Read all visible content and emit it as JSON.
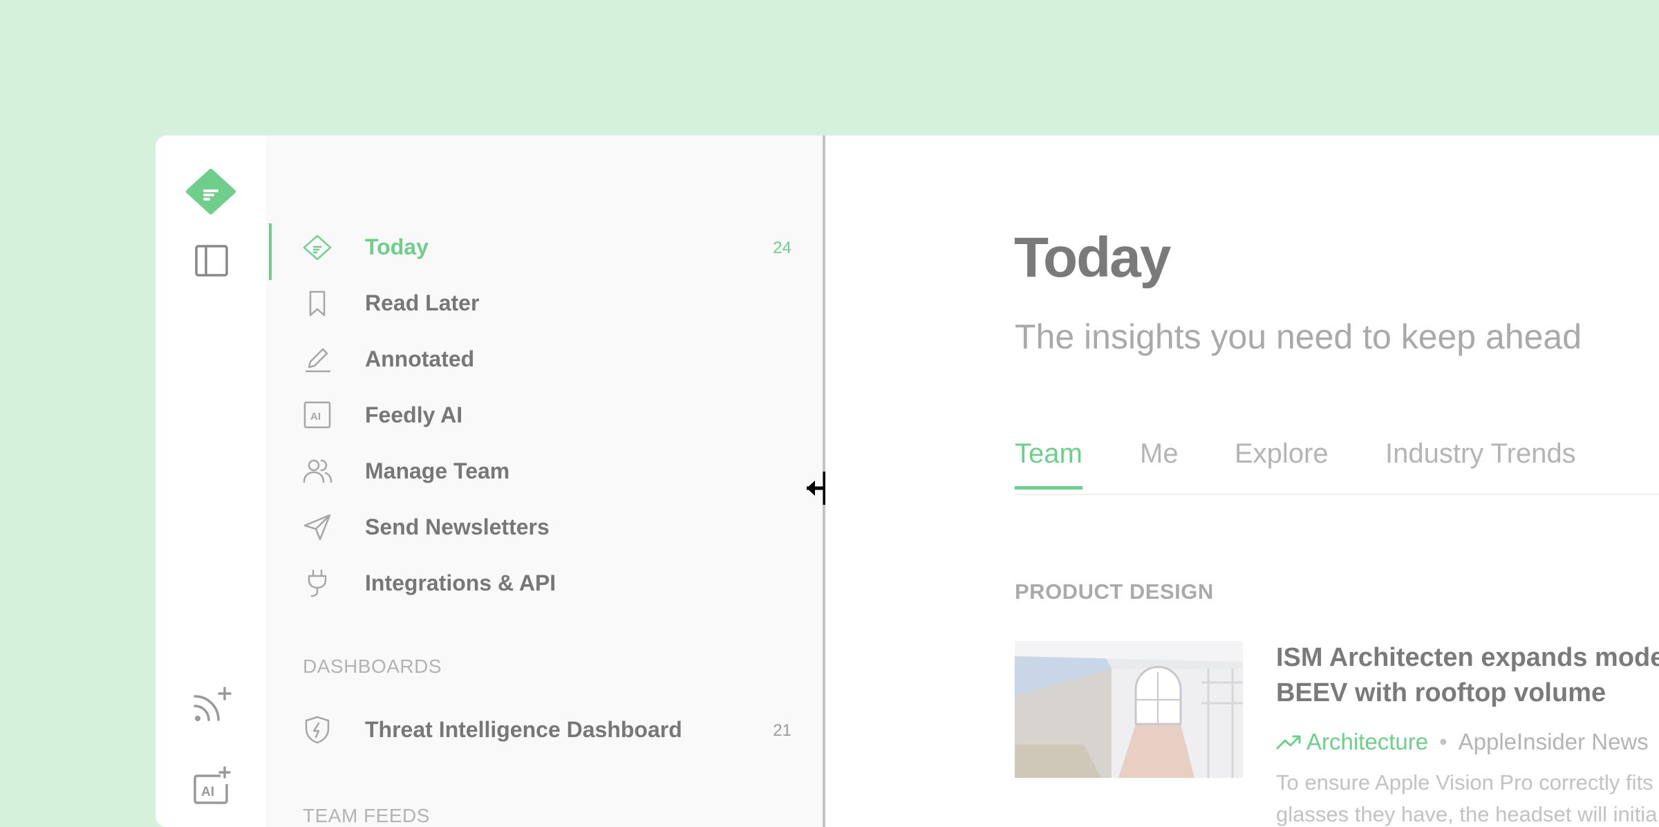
{
  "sidebar": {
    "nav_items": [
      {
        "label": "Today",
        "count": "24"
      },
      {
        "label": "Read Later"
      },
      {
        "label": "Annotated"
      },
      {
        "label": "Feedly AI"
      },
      {
        "label": "Manage Team"
      },
      {
        "label": "Send Newsletters"
      },
      {
        "label": "Integrations & API"
      }
    ],
    "dashboards_header": "DASHBOARDS",
    "dashboards": [
      {
        "label": "Threat Intelligence Dashboard",
        "count": "21"
      }
    ],
    "team_feeds_header": "TEAM FEEDS"
  },
  "icons": {
    "logo": "feedly-logo-icon",
    "toggle": "sidebar-toggle-icon",
    "rss_add": "rss-add-icon",
    "ai_add": "ai-add-icon",
    "feedly_ai_badge": "AI",
    "ai_add_badge": "AI"
  },
  "main": {
    "title": "Today",
    "subtitle": "The insights you need to keep ahead",
    "tabs": [
      "Team",
      "Me",
      "Explore",
      "Industry Trends"
    ],
    "section_label": "PRODUCT DESIGN",
    "article": {
      "title_line1": "ISM Architecten expands modernist",
      "title_line2": "BEEV with rooftop volume",
      "topic": "Architecture",
      "separator": "•",
      "source": "AppleInsider News",
      "excerpt_line1": "To ensure Apple Vision Pro correctly fits",
      "excerpt_line2": "glasses they have, the headset will initia"
    }
  },
  "colors": {
    "accent": "#6fce8c",
    "background": "#d5f1dc",
    "text_primary": "#777777",
    "text_muted": "#b4b4b4"
  }
}
